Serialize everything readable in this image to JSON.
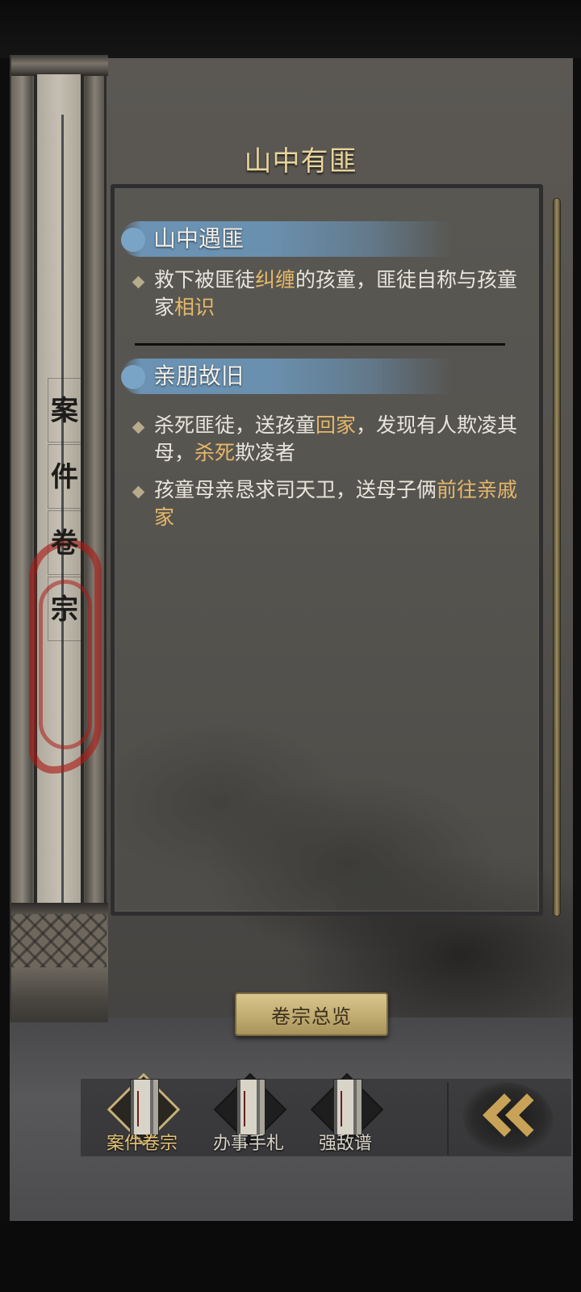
{
  "header": {
    "title": "山中有匪"
  },
  "sidebar_scroll": {
    "title_chars": [
      "案",
      "件",
      "卷",
      "宗"
    ]
  },
  "sections": [
    {
      "title": "山中遇匪",
      "bullets": [
        [
          {
            "text": "救下被匪徒",
            "hl": false
          },
          {
            "text": "纠缠",
            "hl": true
          },
          {
            "text": "的孩童，匪徒自称与孩童家",
            "hl": false
          },
          {
            "text": "相识",
            "hl": true
          }
        ]
      ]
    },
    {
      "title": "亲朋故旧",
      "bullets": [
        [
          {
            "text": "杀死匪徒，送孩童",
            "hl": false
          },
          {
            "text": "回家",
            "hl": true
          },
          {
            "text": "，发现有人欺凌其母，",
            "hl": false
          },
          {
            "text": "杀死",
            "hl": true
          },
          {
            "text": "欺凌者",
            "hl": false
          }
        ],
        [
          {
            "text": "孩童母亲恳求司天卫，送母子俩",
            "hl": false
          },
          {
            "text": "前往亲戚家",
            "hl": true
          }
        ]
      ]
    }
  ],
  "overview_button": {
    "label": "卷宗总览"
  },
  "tabs": [
    {
      "label": "案件卷宗",
      "active": true,
      "icon": "case-file-book-icon"
    },
    {
      "label": "办事手札",
      "active": false,
      "icon": "notebook-icon"
    },
    {
      "label": "强敌谱",
      "active": false,
      "icon": "enemy-register-icon"
    }
  ],
  "back_button": {
    "icon": "double-chevron-left-icon"
  },
  "colors": {
    "highlight": "#e5b869",
    "title": "#e8d49a",
    "brush": "#6c96b9",
    "tab_active": "#e6c476"
  }
}
